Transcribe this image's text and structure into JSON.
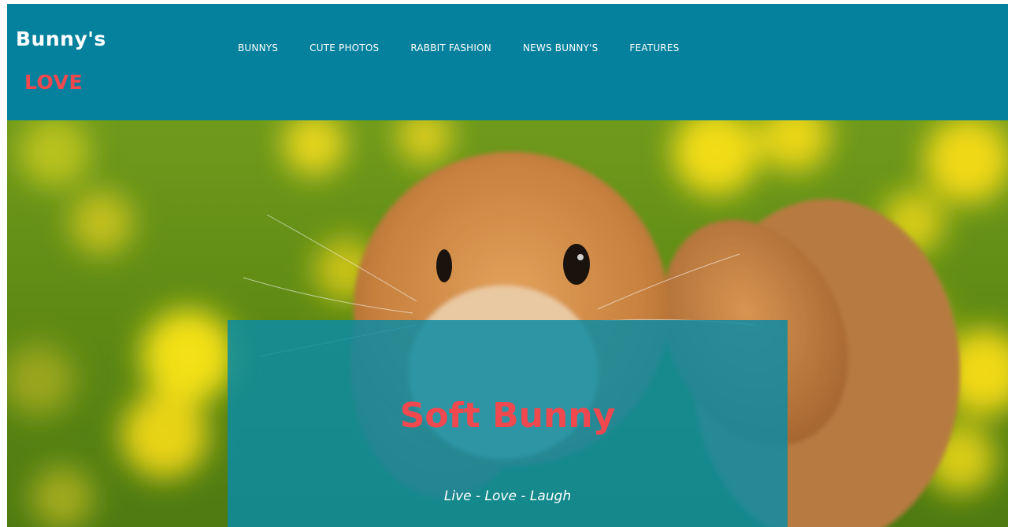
{
  "brand": {
    "line1": "Bunny's",
    "line2": "LOVE",
    "line1_color": "#ffffff",
    "line2_color": "#f0484f"
  },
  "nav": {
    "items": [
      {
        "label": "BUNNYS"
      },
      {
        "label": "CUTE PHOTOS"
      },
      {
        "label": "RABBIT FASHION"
      },
      {
        "label": "NEWS BUNNY'S"
      },
      {
        "label": "FEATURES"
      }
    ]
  },
  "hero": {
    "image": "bunny-photo",
    "title": "Soft Bunny",
    "subtitle": "Live - Love - Laugh"
  },
  "colors": {
    "header_bg": "#05819d",
    "accent": "#f0484f",
    "overlay": "#0a8ca5"
  }
}
